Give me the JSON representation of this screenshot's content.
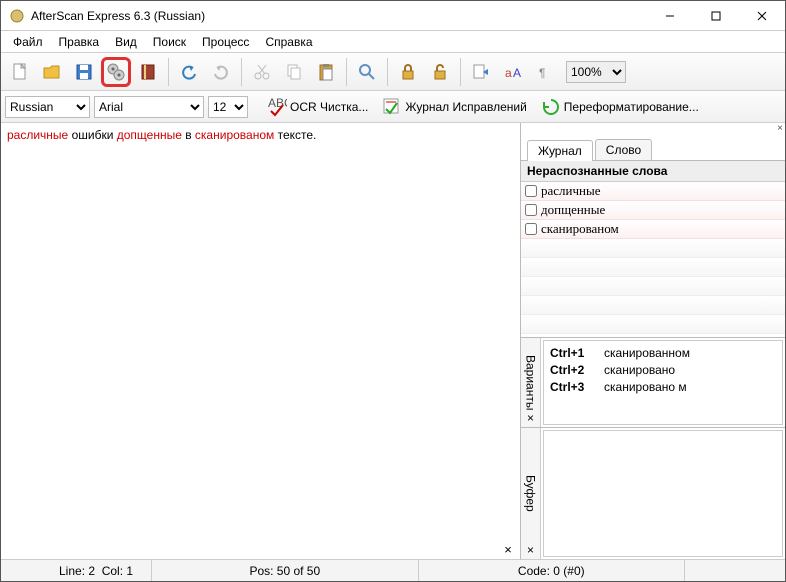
{
  "window": {
    "title": "AfterScan Express 6.3 (Russian)"
  },
  "menu": {
    "file": "Файл",
    "edit": "Правка",
    "view": "Вид",
    "search": "Поиск",
    "process": "Процесс",
    "help": "Справка"
  },
  "toolbar": {
    "zoom": "100%"
  },
  "formatbar": {
    "lang": "Russian",
    "font": "Arial",
    "size": "12",
    "ocr": "OCR Чистка...",
    "journal": "Журнал Исправлений",
    "reformat": "Переформатирование..."
  },
  "editor": {
    "w1": "расличные",
    "t1": " ошибки ",
    "w2": "допщенные",
    "t2": " в ",
    "w3": "сканированом",
    "t3": " тексте."
  },
  "rpane": {
    "tab_journal": "Журнал",
    "tab_word": "Слово",
    "head": "Нераспознанные слова",
    "words": [
      "расличные",
      "допщенные",
      "сканированом"
    ],
    "var_label": "Варианты",
    "buf_label": "Буфер",
    "variants": [
      {
        "k": "Ctrl+1",
        "v": "сканированном"
      },
      {
        "k": "Ctrl+2",
        "v": "сканировано"
      },
      {
        "k": "Ctrl+3",
        "v": "сканировано м"
      }
    ]
  },
  "status": {
    "line": "Line: 2",
    "col": "Col: 1",
    "pos": "Pos: 50 of 50",
    "code": "Code: 0 (#0)"
  }
}
